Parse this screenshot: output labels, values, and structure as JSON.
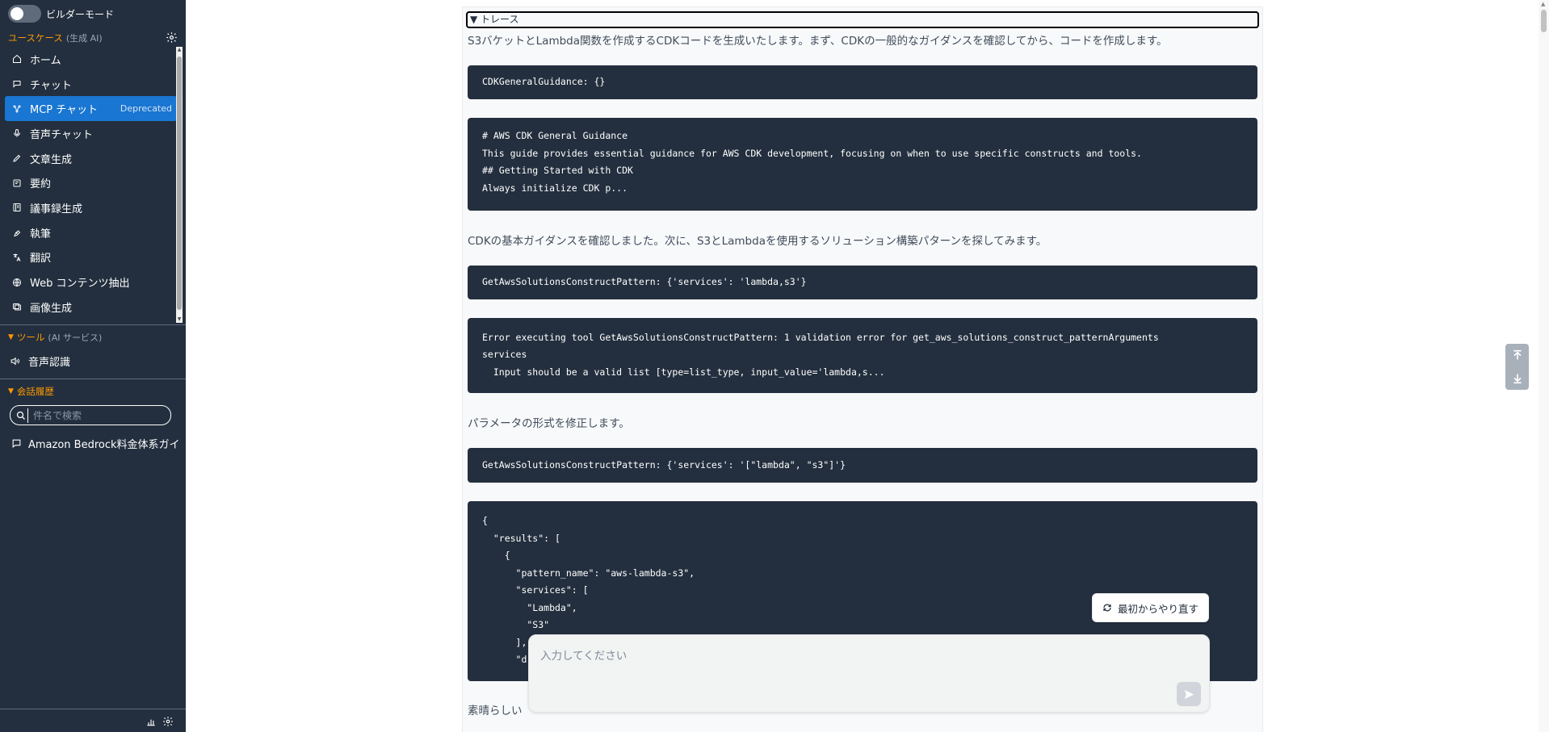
{
  "sidebar": {
    "builder_mode_label": "ビルダーモード",
    "usecase_title": "ユースケース",
    "usecase_sub": "(生成 AI)",
    "items": [
      {
        "label": "ホーム",
        "icon": "home-icon"
      },
      {
        "label": "チャット",
        "icon": "chat-icon"
      },
      {
        "label": "MCP チャット",
        "icon": "mcp-icon",
        "badge": "Deprecated",
        "active": true
      },
      {
        "label": "音声チャット",
        "icon": "mic-icon"
      },
      {
        "label": "文章生成",
        "icon": "pencil-icon"
      },
      {
        "label": "要約",
        "icon": "summary-icon"
      },
      {
        "label": "議事録生成",
        "icon": "minutes-icon"
      },
      {
        "label": "執筆",
        "icon": "pen-icon"
      },
      {
        "label": "翻訳",
        "icon": "translate-icon"
      },
      {
        "label": "Web コンテンツ抽出",
        "icon": "globe-icon"
      },
      {
        "label": "画像生成",
        "icon": "image-icon"
      }
    ],
    "tools_title": "ツール",
    "tools_sub": "(AI サービス)",
    "tool_items": [
      {
        "label": "音声認識",
        "icon": "speaker-icon"
      }
    ],
    "history_title": "会話履歴",
    "search_placeholder": "件名で検索",
    "history_items": [
      {
        "label": "Amazon Bedrock料金体系ガイ"
      }
    ]
  },
  "main": {
    "trace_label": "▼ トレース",
    "intro_text": "S3バケットとLambda関数を作成するCDKコードを生成いたします。まず、CDKの一般的なガイダンスを確認してから、コードを作成します。",
    "code1": [
      "CDKGeneralGuidance: {}"
    ],
    "code2": [
      "# AWS CDK General Guidance",
      "This guide provides essential guidance for AWS CDK development, focusing on when to use specific constructs and tools.",
      "## Getting Started with CDK",
      "Always initialize CDK p..."
    ],
    "text2": "CDKの基本ガイダンスを確認しました。次に、S3とLambdaを使用するソリューション構築パターンを探してみます。",
    "code3": [
      "GetAwsSolutionsConstructPattern: {'services': 'lambda,s3'}"
    ],
    "code4": [
      "Error executing tool GetAwsSolutionsConstructPattern: 1 validation error for get_aws_solutions_construct_patternArguments",
      "services",
      "  Input should be a valid list [type=list_type, input_value='lambda,s..."
    ],
    "text3": "パラメータの形式を修正します。",
    "code5": [
      "GetAwsSolutionsConstructPattern: {'services': '[\"lambda\", \"s3\"]'}"
    ],
    "code6": [
      "{",
      "  \"results\": [",
      "    {",
      "      \"pattern_name\": \"aws-lambda-s3\",",
      "      \"services\": [",
      "        \"Lambda\",",
      "        \"S3\"",
      "      ],",
      "      \"d"
    ],
    "text4": "素晴らしい",
    "restart_label": "最初からやり直す",
    "input_placeholder": "入力してください"
  },
  "colors": {
    "sidebar_bg": "#232f3e",
    "accent_orange": "#ff9900",
    "active_blue": "#1976d2",
    "avatar_green": "#0e9b7a",
    "code_bg": "#232f3e"
  }
}
